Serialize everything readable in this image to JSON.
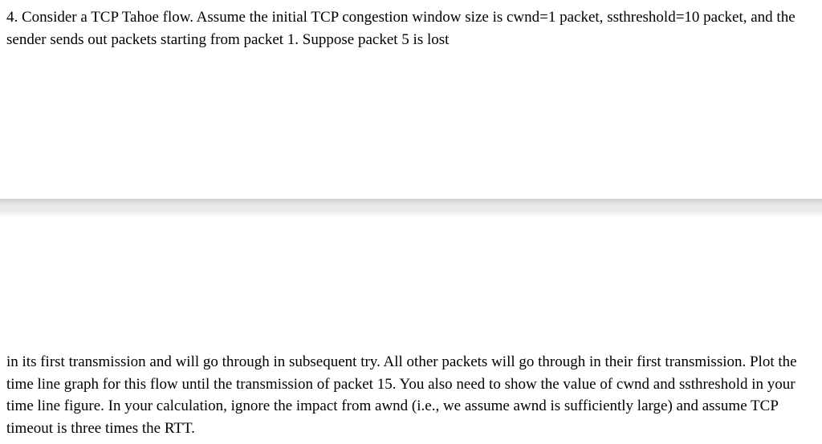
{
  "top_paragraph": "4. Consider a TCP Tahoe flow. Assume the initial TCP congestion window size is cwnd=1 packet, ssthreshold=10 packet, and the sender sends out packets starting from packet 1. Suppose packet 5 is lost",
  "bottom_paragraph": "in its first transmission and will go through in subsequent try. All other packets will go through in their first transmission. Plot the time line graph for this flow until the transmission of packet 15. You also need to show the value of cwnd and ssthreshold in your time line figure. In your calculation, ignore the impact from awnd (i.e., we assume awnd is sufficiently large) and assume TCP timeout is three times the RTT."
}
